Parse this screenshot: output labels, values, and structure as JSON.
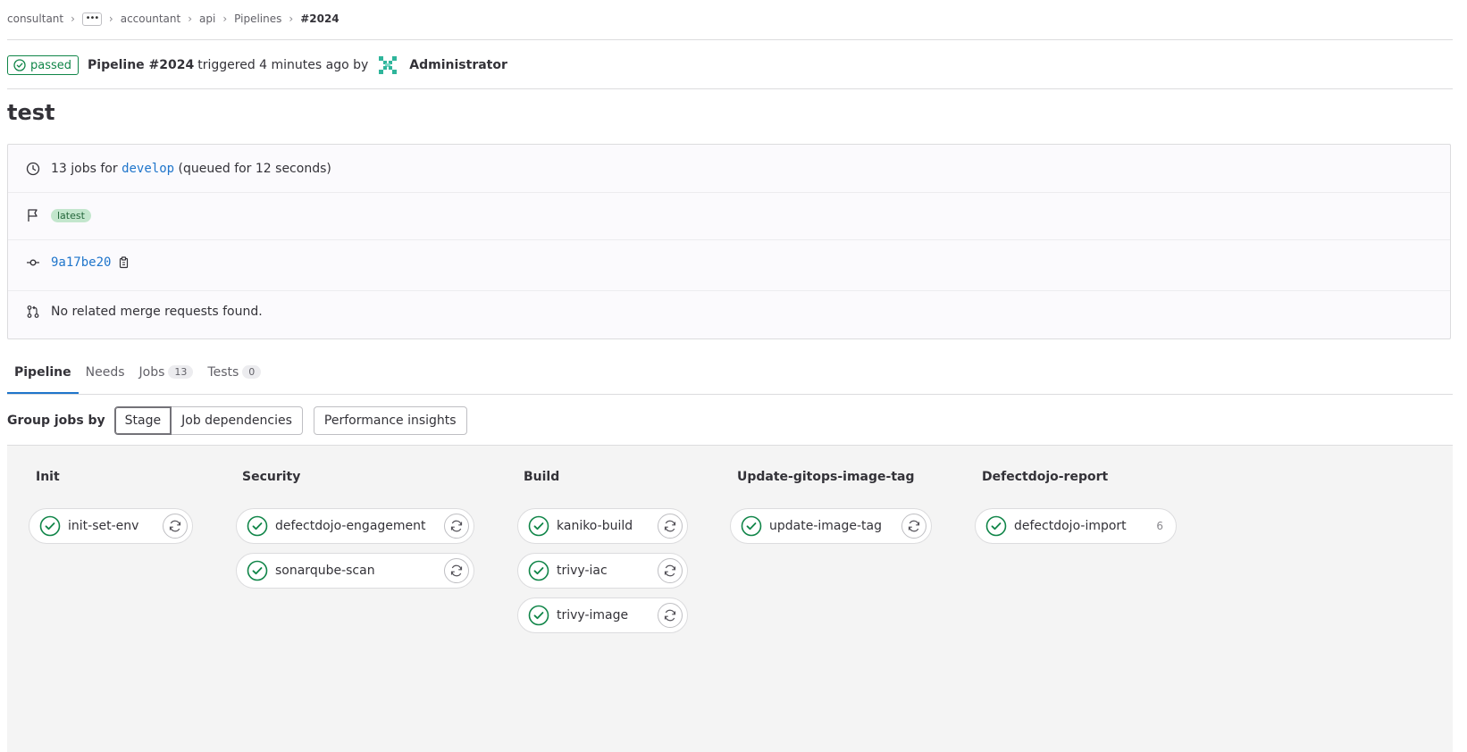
{
  "breadcrumb": {
    "items": [
      "consultant",
      "accountant",
      "api",
      "Pipelines"
    ],
    "more": "•••",
    "current": "#2024"
  },
  "header": {
    "status": "passed",
    "pipeline_label": "Pipeline #2024",
    "triggered_text": "triggered 4 minutes ago by",
    "user": "Administrator"
  },
  "title": "test",
  "info": {
    "jobs_count_text": "13 jobs for",
    "branch": "develop",
    "queued_text": "(queued for 12 seconds)",
    "tag": "latest",
    "commit_sha": "9a17be20",
    "merge_requests_text": "No related merge requests found."
  },
  "tabs": [
    {
      "label": "Pipeline",
      "count": null
    },
    {
      "label": "Needs",
      "count": null
    },
    {
      "label": "Jobs",
      "count": "13"
    },
    {
      "label": "Tests",
      "count": "0"
    }
  ],
  "group_by": {
    "label": "Group jobs by",
    "options": [
      "Stage",
      "Job dependencies"
    ],
    "selected": "Stage",
    "performance_button": "Performance insights"
  },
  "stages": [
    {
      "name": "Init",
      "jobs": [
        {
          "name": "init-set-env",
          "status": "success"
        }
      ]
    },
    {
      "name": "Security",
      "jobs": [
        {
          "name": "defectdojo-engagement",
          "status": "success"
        },
        {
          "name": "sonarqube-scan",
          "status": "success"
        }
      ]
    },
    {
      "name": "Build",
      "jobs": [
        {
          "name": "kaniko-build",
          "status": "success"
        },
        {
          "name": "trivy-iac",
          "status": "success"
        },
        {
          "name": "trivy-image",
          "status": "success"
        }
      ]
    },
    {
      "name": "Update-gitops-image-tag",
      "jobs": [
        {
          "name": "update-image-tag",
          "status": "success"
        }
      ]
    },
    {
      "name": "Defectdojo-report",
      "jobs": [
        {
          "name": "defectdojo-import",
          "status": "success",
          "group_count": "6"
        }
      ]
    }
  ],
  "colors": {
    "success": "#108548",
    "link": "#1f75cb",
    "tab_active": "#1f75cb"
  }
}
